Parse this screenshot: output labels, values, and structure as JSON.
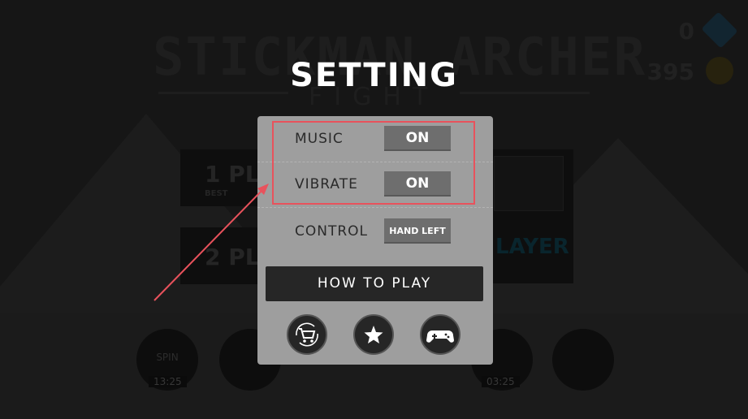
{
  "background": {
    "game_title": "STICKMAN ARCHER",
    "game_subtitle": "FIGHT",
    "gems_count": "0",
    "coins_count": "395",
    "menu_1p_label": "1 PL",
    "menu_1p_small": "BEST",
    "menu_2p_label": "2 PL",
    "menu_right_label": "LAYER",
    "spin_label": "SPIN",
    "spin_timer": "13:25",
    "gift_timer": "03:25"
  },
  "dialog": {
    "title": "SETTING",
    "rows": [
      {
        "label": "MUSIC",
        "value": "ON"
      },
      {
        "label": "VIBRATE",
        "value": "ON"
      },
      {
        "label": "CONTROL",
        "value": "HAND LEFT"
      }
    ],
    "how_to_play_label": "HOW TO PLAY",
    "icons": [
      "shop-refresh-icon",
      "star-icon",
      "gamepad-icon"
    ]
  },
  "annotation": {
    "highlight_color": "#e8525c"
  }
}
